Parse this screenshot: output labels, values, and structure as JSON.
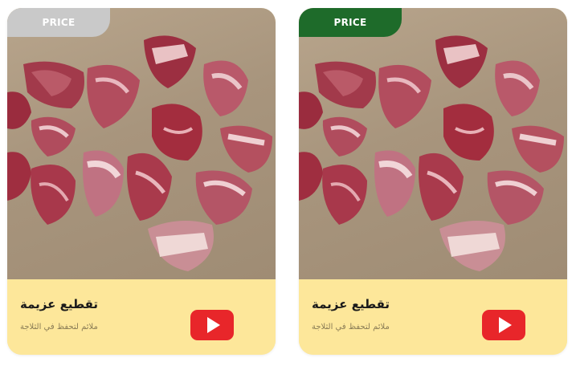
{
  "cards": [
    {
      "badge_label": "PRICE",
      "badge_color": "#c9c9c9",
      "title": "تقطيع عزيمة",
      "subtitle": "ملائم لتحفظ في الثلاجة",
      "image_alt": "meat-cuts-photo",
      "play_icon": "play-icon",
      "play_color": "#e8262a"
    },
    {
      "badge_label": "PRICE",
      "badge_color": "#1e6b2a",
      "title": "تقطيع عزيمة",
      "subtitle": "ملائم لتحفظ في الثلاجة",
      "image_alt": "meat-cuts-photo",
      "play_icon": "play-icon",
      "play_color": "#e8262a"
    }
  ],
  "colors": {
    "card_background": "#fde79a",
    "badge_text": "#ffffff"
  }
}
